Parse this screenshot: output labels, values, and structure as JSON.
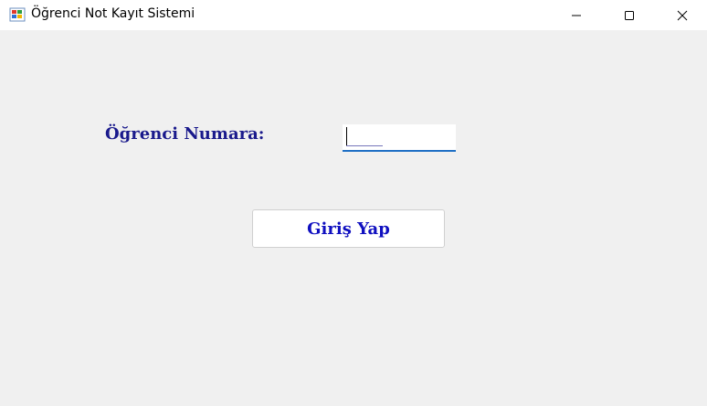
{
  "window": {
    "title": "Öğrenci Not Kayıt Sistemi",
    "app_icon": "windows-form-icon",
    "controls": {
      "minimize_icon": "minimize-icon",
      "maximize_icon": "maximize-icon",
      "close_icon": "close-icon"
    }
  },
  "form": {
    "student_number_label": "Öğrenci Numara:",
    "student_number_input": {
      "value": "",
      "placeholder": "_____"
    },
    "login_button_label": "Giriş Yap"
  },
  "colors": {
    "label_text": "#1a1a8c",
    "button_text": "#1010c0",
    "input_underline": "#1f6fc5",
    "background": "#f0f0f0"
  }
}
